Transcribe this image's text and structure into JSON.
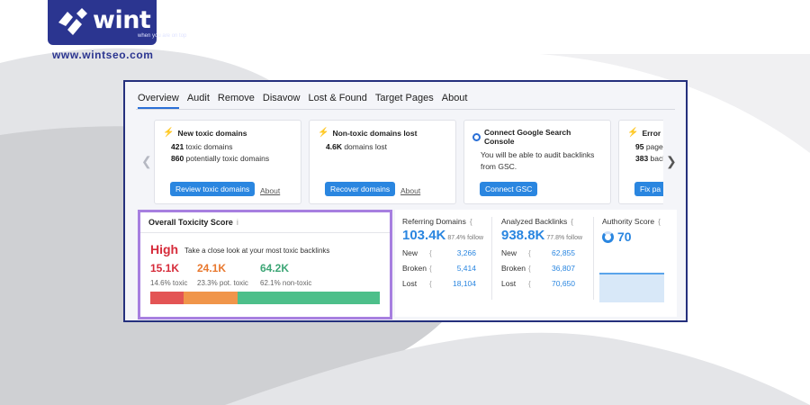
{
  "brand": {
    "logo_text": "wint",
    "tagline": "when you are on top",
    "url": "www.wintseo.com",
    "color": "#2b3590"
  },
  "tabs": [
    "Overview",
    "Audit",
    "Remove",
    "Disavow",
    "Lost & Found",
    "Target Pages",
    "About"
  ],
  "cards": [
    {
      "title": "New toxic domains",
      "icon": "bolt-icon",
      "lines": [
        {
          "b": "421",
          "t": " toxic domains"
        },
        {
          "b": "860",
          "t": " potentially toxic domains"
        }
      ],
      "button": "Review toxic domains",
      "about": "About"
    },
    {
      "title": "Non-toxic domains lost",
      "icon": "bolt-icon",
      "lines": [
        {
          "b": "4.6K",
          "t": " domains lost"
        }
      ],
      "button": "Recover domains",
      "about": "About"
    },
    {
      "title": "Connect Google Search Console",
      "icon": "google-icon",
      "lines": [
        {
          "b": "",
          "t": "You will be able to audit backlinks"
        },
        {
          "b": "",
          "t": "from GSC."
        }
      ],
      "button": "Connect GSC",
      "about": ""
    },
    {
      "title": "Error pa",
      "icon": "bolt-icon",
      "lines": [
        {
          "b": "95",
          "t": " page"
        },
        {
          "b": "383",
          "t": " back"
        }
      ],
      "button": "Fix pa",
      "about": ""
    }
  ],
  "toxicity": {
    "title": "Overall Toxicity Score",
    "info": "i",
    "level": "High",
    "description": "Take a close look at your most toxic backlinks",
    "toxic_val": "15.1K",
    "toxic_sub": "14.6% toxic",
    "pot_val": "24.1K",
    "pot_sub": "23.3% pot. toxic",
    "non_val": "64.2K",
    "non_sub": "62.1% non-toxic",
    "bar_fractions": [
      0.146,
      0.233,
      0.621
    ],
    "colors": {
      "toxic": "#e35454",
      "pot": "#f0954a",
      "non": "#4dbf8a"
    }
  },
  "referring": {
    "title": "Referring Domains",
    "info": "{",
    "value": "103.4K",
    "follow": "87.4% follow",
    "rows": [
      {
        "k": "New",
        "v": "3,266"
      },
      {
        "k": "Broken",
        "v": "5,414"
      },
      {
        "k": "Lost",
        "v": "18,104"
      }
    ]
  },
  "backlinks": {
    "title": "Analyzed Backlinks",
    "info": "{",
    "value": "938.8K",
    "follow": "77.8% follow",
    "rows": [
      {
        "k": "New",
        "v": "62,855"
      },
      {
        "k": "Broken",
        "v": "36,807"
      },
      {
        "k": "Lost",
        "v": "70,650"
      }
    ]
  },
  "authority": {
    "title": "Authority Score",
    "info": "{",
    "value": "70"
  },
  "accent": "#2a86e0"
}
